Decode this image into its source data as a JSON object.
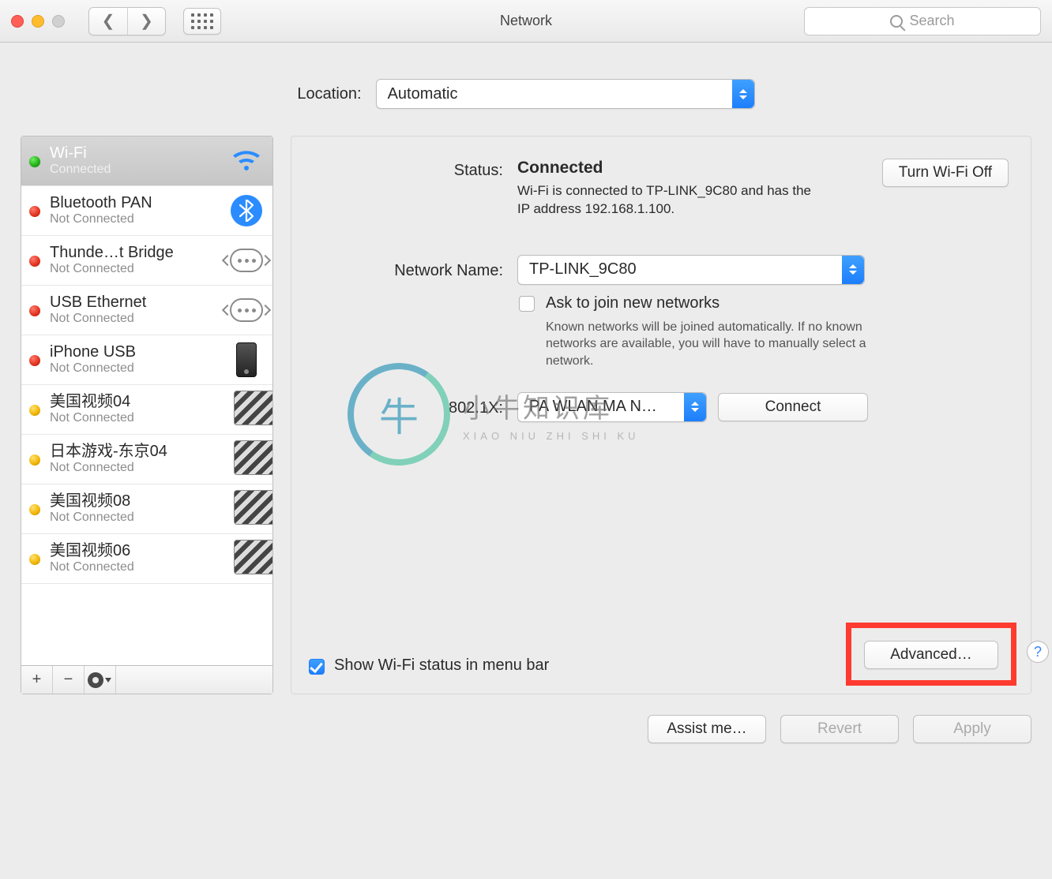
{
  "window": {
    "title": "Network",
    "search_placeholder": "Search"
  },
  "location": {
    "label": "Location:",
    "value": "Automatic"
  },
  "sidebar": {
    "items": [
      {
        "name": "Wi-Fi",
        "status": "Connected",
        "dot": "green",
        "icon": "wifi"
      },
      {
        "name": "Bluetooth PAN",
        "status": "Not Connected",
        "dot": "red",
        "icon": "bluetooth"
      },
      {
        "name": "Thunde…t Bridge",
        "status": "Not Connected",
        "dot": "red",
        "icon": "dongle"
      },
      {
        "name": "USB Ethernet",
        "status": "Not Connected",
        "dot": "red",
        "icon": "dongle"
      },
      {
        "name": "iPhone USB",
        "status": "Not Connected",
        "dot": "red",
        "icon": "phone"
      },
      {
        "name": "美国视频04",
        "status": "Not Connected",
        "dot": "yellow",
        "icon": "lock"
      },
      {
        "name": "日本游戏-东京04",
        "status": "Not Connected",
        "dot": "yellow",
        "icon": "lock"
      },
      {
        "name": "美国视频08",
        "status": "Not Connected",
        "dot": "yellow",
        "icon": "lock"
      },
      {
        "name": "美国视频06",
        "status": "Not Connected",
        "dot": "yellow",
        "icon": "lock"
      }
    ],
    "footer": {
      "add": "+",
      "remove": "−",
      "gear": "gear"
    }
  },
  "detail": {
    "status_label": "Status:",
    "status_value": "Connected",
    "wifi_off_button": "Turn Wi-Fi Off",
    "status_desc": "Wi-Fi is connected to TP-LINK_9C80 and has the IP address 192.168.1.100.",
    "network_name_label": "Network Name:",
    "network_name_value": "TP-LINK_9C80",
    "ask_join_label": "Ask to join new networks",
    "ask_join_hint": "Known networks will be joined automatically. If no known networks are available, you will have to manually select a network.",
    "x802_label": "802.1X:",
    "x802_value": "PA WLAN MA N…",
    "connect_button": "Connect",
    "menubar_label": "Show Wi-Fi status in menu bar",
    "advanced_button": "Advanced…",
    "help": "?"
  },
  "buttons": {
    "assist": "Assist me…",
    "revert": "Revert",
    "apply": "Apply"
  },
  "watermark": {
    "big": "小牛知识库",
    "small": "XIAO NIU ZHI SHI KU"
  }
}
